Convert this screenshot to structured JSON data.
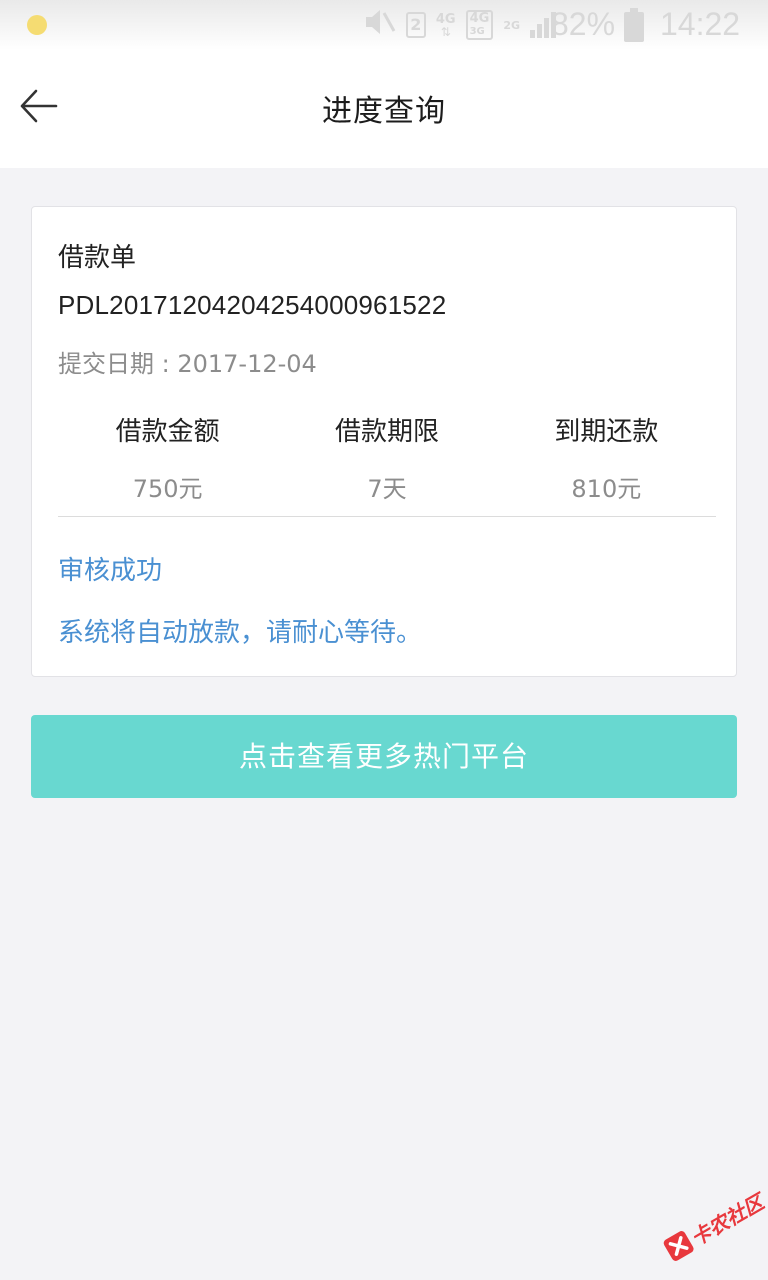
{
  "status_bar": {
    "battery": "82%",
    "time": "14:22",
    "sim_slot": "2",
    "network_1": "4G",
    "network_2": "4G",
    "network_2b": "3G",
    "network_3": "2G"
  },
  "header": {
    "title": "进度查询",
    "back_icon": "arrow-left-icon"
  },
  "loan_card": {
    "type_label": "借款单",
    "order_number": "PDL20171204204254000961522",
    "submit_date": "提交日期 : 2017-12-04",
    "stats": [
      {
        "label": "借款金额",
        "value": "750元"
      },
      {
        "label": "借款期限",
        "value": "7天"
      },
      {
        "label": "到期还款",
        "value": "810元"
      }
    ],
    "status": "审核成功",
    "status_message": "系统将自动放款，请耐心等待。"
  },
  "actions": {
    "more_platforms_label": "点击查看更多热门平台"
  },
  "watermark": {
    "text": "卡农社区"
  },
  "colors": {
    "accent_teal": "#68d8d0",
    "status_blue": "#4a90d2",
    "page_background": "#f3f3f6"
  }
}
